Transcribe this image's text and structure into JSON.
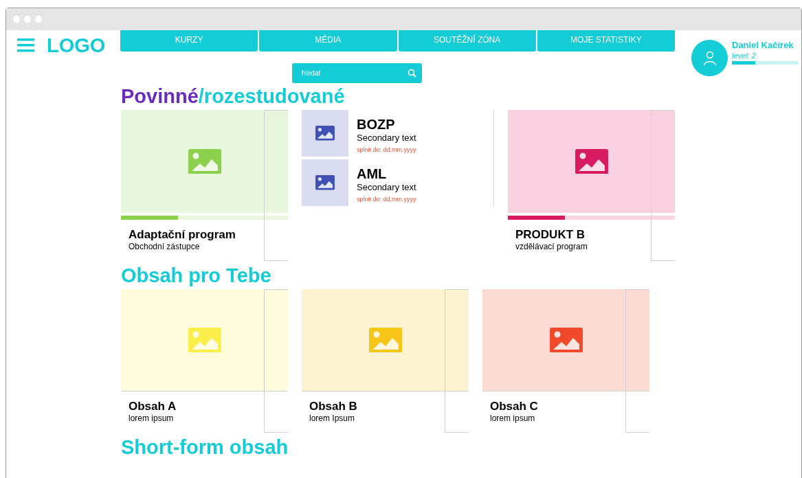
{
  "logo": "LOGO",
  "nav": [
    {
      "label": "KURZY"
    },
    {
      "label": "MÉDIA"
    },
    {
      "label": "SOUTĚŽNÍ ZÓNA"
    },
    {
      "label": "MOJE STATISTIKY"
    }
  ],
  "user": {
    "name": "Daniel Kačírek",
    "level_text": "level: 2",
    "level": 0.35
  },
  "search": {
    "placeholder": "hledat"
  },
  "sections": [
    {
      "title_parts": [
        "Povinné",
        "/rozestudované"
      ],
      "items": [
        {
          "kind": "card",
          "title": "Adaptační program",
          "subtitle": "Obchodní zástupce",
          "color": "#8bd14c",
          "level": 0.34
        },
        {
          "kind": "list",
          "entries": [
            {
              "title": "BOZP",
              "secondary": "Secondary text",
              "deadline": "splnit do: dd.mm.yyyy"
            },
            {
              "title": "AML",
              "secondary": "Secondary text",
              "deadline": "splnit do: dd.mm.yyyy"
            }
          ]
        },
        {
          "kind": "card",
          "title": "PRODUKT B",
          "subtitle": "vzdělávací program",
          "color": "#d81b60",
          "level": 0.34
        }
      ]
    },
    {
      "title_parts": [
        "Obsah pro Tebe"
      ],
      "items": [
        {
          "kind": "card",
          "title": "Obsah A",
          "subtitle": "lorem ipsum",
          "color": "#fbee4a"
        },
        {
          "kind": "card",
          "title": "Obsah B",
          "subtitle": "lorem Ipsum",
          "color": "#f6c518"
        },
        {
          "kind": "card",
          "title": "Obsah C",
          "subtitle": "lorem ipsum",
          "color": "#f04a2a"
        }
      ]
    },
    {
      "title_parts": [
        "Short-form obsah"
      ]
    }
  ]
}
